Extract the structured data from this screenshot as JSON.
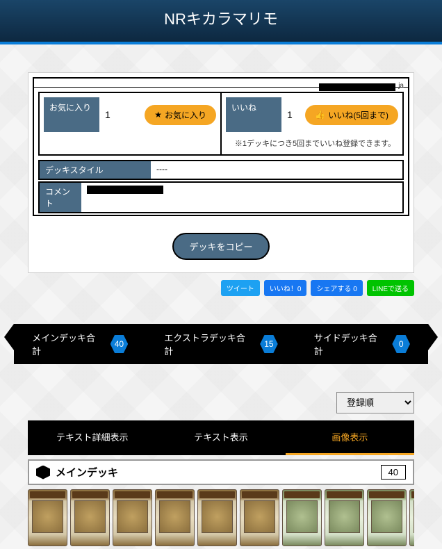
{
  "header": {
    "title": "NRキカラマリモ"
  },
  "url_suffix": "ja",
  "favorite": {
    "label": "お気に入り",
    "count": "1",
    "button": "お気に入り"
  },
  "like": {
    "label": "いいね",
    "count": "1",
    "button": "いいね(5回まで)",
    "note": "※1デッキにつき5回までいいね登録できます。"
  },
  "style": {
    "label": "デッキスタイル",
    "value": "----"
  },
  "comment": {
    "label": "コメント"
  },
  "copy": "デッキをコピー",
  "social": {
    "tweet": "ツイート",
    "fblike": "いいね！0",
    "fbshare": "シェアする 0",
    "line": "LINEで送る"
  },
  "counts": {
    "main": {
      "label": "メインデッキ合計",
      "n": "40"
    },
    "extra": {
      "label": "エクストラデッキ合計",
      "n": "15"
    },
    "side": {
      "label": "サイドデッキ合計",
      "n": "0"
    }
  },
  "sort": {
    "selected": "登録順"
  },
  "tabs": {
    "detail": "テキスト詳細表示",
    "text": "テキスト表示",
    "image": "画像表示"
  },
  "deck": {
    "title": "メインデッキ",
    "count": "40"
  }
}
